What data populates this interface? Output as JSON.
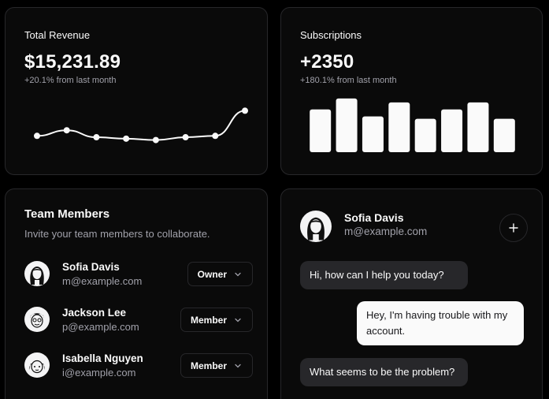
{
  "revenue": {
    "label": "Total Revenue",
    "value": "$15,231.89",
    "change": "+20.1% from last month"
  },
  "subscriptions": {
    "label": "Subscriptions",
    "value": "+2350",
    "change": "+180.1% from last month"
  },
  "chart_data": [
    {
      "type": "line",
      "title": "",
      "values": [
        10,
        14,
        9,
        8,
        7,
        9,
        10,
        28
      ],
      "ylim": [
        0,
        35
      ],
      "grid": false,
      "color": "#fafafa"
    },
    {
      "type": "bar",
      "title": "",
      "values": [
        55,
        69,
        46,
        64,
        43,
        55,
        64,
        43
      ],
      "ylim": [
        0,
        75
      ],
      "grid": false,
      "color": "#fafafa"
    }
  ],
  "team": {
    "title": "Team Members",
    "description": "Invite your team members to collaborate.",
    "members": [
      {
        "name": "Sofia Davis",
        "email": "m@example.com",
        "role": "Owner"
      },
      {
        "name": "Jackson Lee",
        "email": "p@example.com",
        "role": "Member"
      },
      {
        "name": "Isabella Nguyen",
        "email": "i@example.com",
        "role": "Member"
      }
    ]
  },
  "chat": {
    "contact_name": "Sofia Davis",
    "contact_email": "m@example.com",
    "messages": [
      {
        "from": "agent",
        "text": "Hi, how can I help you today?"
      },
      {
        "from": "user",
        "text": "Hey, I'm having trouble with my account."
      },
      {
        "from": "agent",
        "text": "What seems to be the problem?"
      }
    ]
  },
  "colors": {
    "background": "#000000",
    "card": "#0a0a0a",
    "border": "#27272a",
    "muted_text": "#a1a1aa",
    "foreground": "#fafafa"
  },
  "icons": {
    "role_dropdown": "chevron-down-icon",
    "add": "plus-icon"
  }
}
